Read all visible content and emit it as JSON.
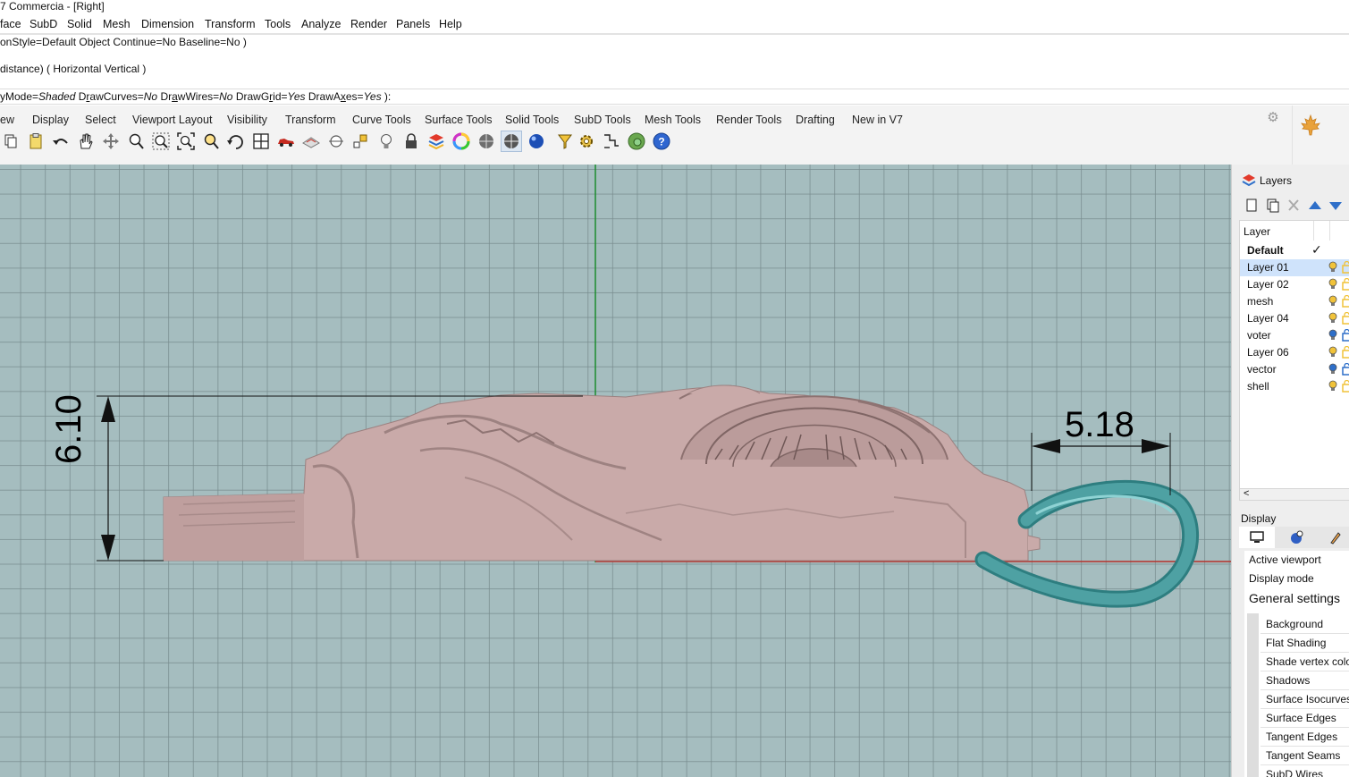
{
  "window": {
    "title": "7 Commercia - [Right]"
  },
  "menu": [
    "face",
    "SubD",
    "Solid",
    "Mesh",
    "Dimension",
    "Transform",
    "Tools",
    "Analyze",
    "Render",
    "Panels",
    "Help"
  ],
  "command_history": {
    "line1": "onStyle=Default  Object  Continue=No  Baseline=No )",
    "line2": "distance) ( Horizontal  Vertical )"
  },
  "command_prompt": {
    "p1": "yMode=",
    "v1": "Shaded",
    "p2": "  D",
    "u2": "r",
    "p2b": "awCurves=",
    "v2": "No",
    "p3": "  Dr",
    "u3": "a",
    "p3b": "wWires=",
    "v3": "No",
    "p4": "  DrawG",
    "u4": "r",
    "p4b": "id=",
    "v4": "Yes",
    "p5": "  DrawA",
    "u5": "x",
    "p5b": "es=",
    "v5": "Yes",
    "p6": " ):"
  },
  "toolbar_tabs": [
    "ew",
    "Display",
    "Select",
    "Viewport Layout",
    "Visibility",
    "Transform",
    "Curve Tools",
    "Surface Tools",
    "Solid Tools",
    "SubD Tools",
    "Mesh Tools",
    "Render Tools",
    "Drafting",
    "New in V7"
  ],
  "toolbar_icons": [
    "copy-icon",
    "clipboard-icon",
    "undo-icon",
    "pan-hand-icon",
    "move-view-icon",
    "zoom-in-icon",
    "zoom-window-icon",
    "zoom-extents-icon",
    "zoom-selected-icon",
    "rotate-view-icon",
    "grid-viewports-icon",
    "car-view-icon",
    "plane-view-icon",
    "object-snap-icon",
    "point-icon",
    "lightbulb-icon",
    "lock-icon",
    "layer-icon",
    "color-wheel-icon",
    "rendered-sphere-icon",
    "shaded-sphere-icon",
    "blue-sphere-icon",
    "select-filter-icon",
    "options-gear-icon",
    "dimension-icon",
    "globe-icon",
    "help-icon"
  ],
  "viewport": {
    "dimension_vertical": "6.10",
    "dimension_horizontal": "5.18",
    "grid_color": "#a5bdbf",
    "model_color": "#c7a9a8",
    "loop_color": "#4e9ea0"
  },
  "layers_panel": {
    "tab_label": "Layers",
    "column_header": "Layer",
    "layers": [
      {
        "name": "Default",
        "current": true,
        "bold": true,
        "bulb": "",
        "lock": ""
      },
      {
        "name": "Layer 01",
        "selected": true,
        "bulb": "yellow",
        "lock": "yellow"
      },
      {
        "name": "Layer 02",
        "bulb": "yellow",
        "lock": "yellow"
      },
      {
        "name": "mesh",
        "bulb": "yellow",
        "lock": "yellow"
      },
      {
        "name": "Layer 04",
        "bulb": "yellow",
        "lock": "yellow"
      },
      {
        "name": "voter",
        "bulb": "blue",
        "lock": "blue"
      },
      {
        "name": "Layer 06",
        "bulb": "yellow",
        "lock": "yellow"
      },
      {
        "name": "vector",
        "bulb": "blue",
        "lock": "blue"
      },
      {
        "name": "shell",
        "bulb": "yellow",
        "lock": "yellow"
      }
    ],
    "scroll_left": "<"
  },
  "display_panel": {
    "title": "Display",
    "active_viewport": "Active viewport",
    "display_mode": "Display mode",
    "general_settings": "General settings",
    "items": [
      "Background",
      "Flat Shading",
      "Shade vertex colo",
      "Shadows",
      "Surface Isocurves",
      "Surface Edges",
      "Tangent Edges",
      "Tangent Seams",
      "SubD Wires"
    ]
  }
}
